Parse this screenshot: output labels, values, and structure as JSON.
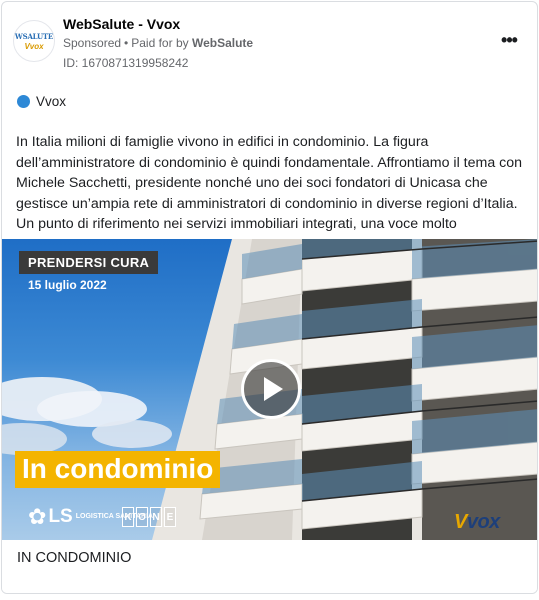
{
  "header": {
    "page_name": "WebSalute - Vvox",
    "sponsored": "Sponsored",
    "separator": "•",
    "paid_for_prefix": "Paid for by",
    "paid_for_name": "WebSalute",
    "ad_id": "ID: 1670871319958242",
    "more_label": "•••",
    "avatar_line1": "WSALUTE",
    "avatar_line2": "Vvox"
  },
  "target": {
    "label": "Vvox",
    "color": "#2d88d6"
  },
  "body": {
    "text": "In Italia milioni di famiglie vivono in edifici in condominio. La figura dell’amministratore di condominio è quindi fondamentale. Affrontiamo il tema con Michele Sacchetti, presidente nonché uno dei soci fondatori di Unicasa che gestisce un’ampia rete di amministratori di condominio in diverse regioni d’Italia. Un punto di riferimento nei servizi immobiliari integrati, una voce molto autorevol…"
  },
  "media": {
    "tag": "PRENDERSI CURA",
    "date": "15 luglio 2022",
    "banner": "In condominio",
    "banner_color": "#f4b400",
    "sponsor1_mark": "LS",
    "sponsor1_words": "LOGISTICA SANITARIA",
    "sponsor2_letters": [
      "K",
      "O",
      "N",
      "E"
    ],
    "brand_logo_first": "V",
    "brand_logo_rest": "vox",
    "play_icon": "play-icon"
  },
  "caption": {
    "text": "IN CONDOMINIO"
  }
}
